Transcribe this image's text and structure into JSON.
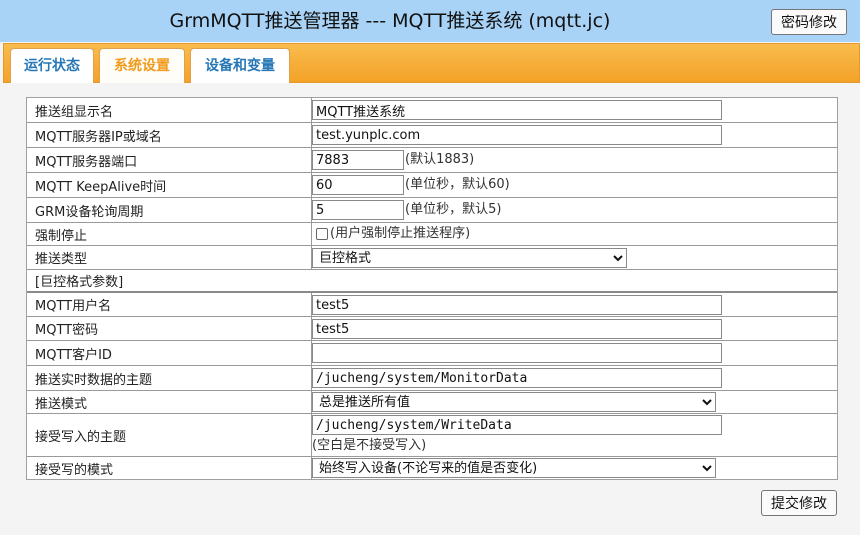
{
  "header": {
    "title": "GrmMQTT推送管理器 --- MQTT推送系统 (mqtt.jc)",
    "password_button": "密码修改"
  },
  "tabs": [
    {
      "label": "运行状态",
      "active": false
    },
    {
      "label": "系统设置",
      "active": true
    },
    {
      "label": "设备和变量",
      "active": false
    }
  ],
  "form": {
    "group_name": {
      "label": "推送组显示名",
      "value": "MQTT推送系统"
    },
    "server": {
      "label": "MQTT服务器IP或域名",
      "value": "test.yunplc.com"
    },
    "port": {
      "label": "MQTT服务器端口",
      "value": "7883",
      "hint": "(默认1883)"
    },
    "keepalive": {
      "label": "MQTT KeepAlive时间",
      "value": "60",
      "hint": "(单位秒，默认60)"
    },
    "poll": {
      "label": "GRM设备轮询周期",
      "value": "5",
      "hint": "(单位秒，默认5)"
    },
    "force_stop": {
      "label": "强制停止",
      "checked": false,
      "hint": "(用户强制停止推送程序)"
    },
    "push_type": {
      "label": "推送类型",
      "selected": "巨控格式"
    },
    "section_title": "[巨控格式参数]",
    "username": {
      "label": "MQTT用户名",
      "value": "test5"
    },
    "password": {
      "label": "MQTT密码",
      "value": "test5"
    },
    "client_id": {
      "label": "MQTT客户ID",
      "value": ""
    },
    "realtime_topic": {
      "label": "推送实时数据的主题",
      "value": "/jucheng/system/MonitorData"
    },
    "push_mode": {
      "label": "推送模式",
      "selected": "总是推送所有值"
    },
    "write_topic": {
      "label": "接受写入的主题",
      "value": "/jucheng/system/WriteData",
      "hint": "(空白是不接受写入)"
    },
    "write_mode": {
      "label": "接受写的模式",
      "selected": "始终写入设备(不论写来的值是否变化)"
    }
  },
  "submit_button": "提交修改"
}
